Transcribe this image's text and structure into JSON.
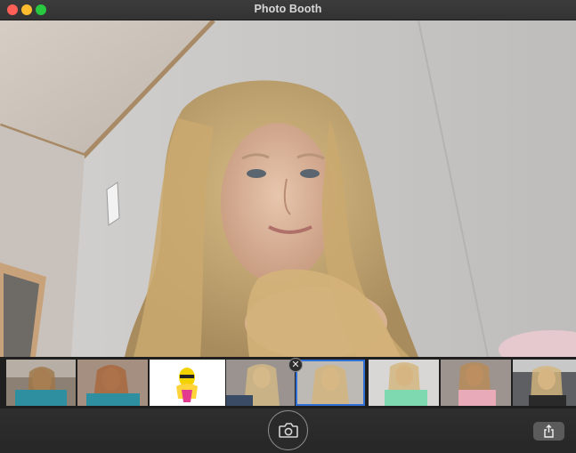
{
  "window": {
    "title": "Photo Booth",
    "traffic_lights": {
      "close": "#ff5f57",
      "minimize": "#febc2e",
      "zoom": "#28c840"
    }
  },
  "thumbnails": [
    {
      "id": 1,
      "selected": false
    },
    {
      "id": 2,
      "selected": false
    },
    {
      "id": 3,
      "selected": false
    },
    {
      "id": 4,
      "selected": false
    },
    {
      "id": 5,
      "selected": true
    },
    {
      "id": 6,
      "selected": false
    },
    {
      "id": 7,
      "selected": false
    },
    {
      "id": 8,
      "selected": false
    }
  ],
  "icons": {
    "delete": "close-icon",
    "shutter": "camera-icon",
    "share": "share-icon"
  },
  "colors": {
    "selection": "#2f6fd6"
  }
}
